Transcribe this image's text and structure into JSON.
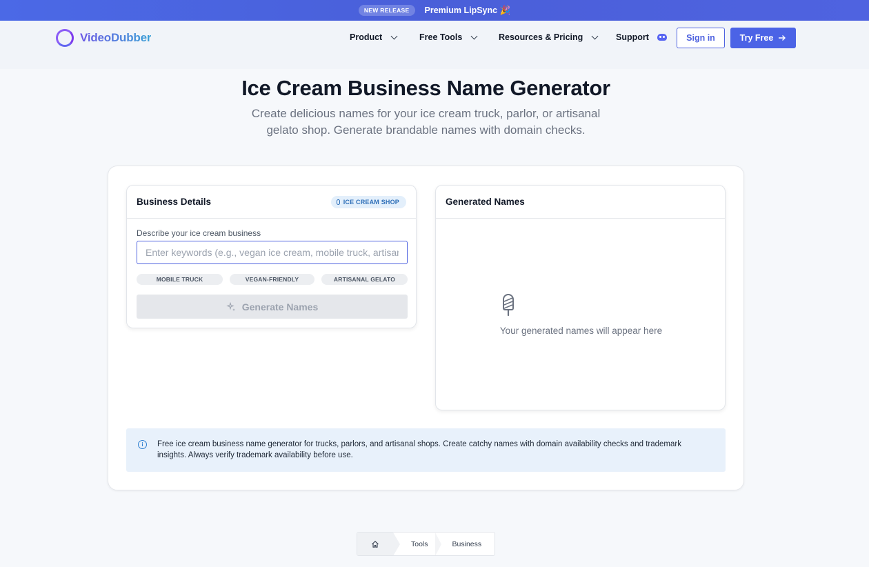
{
  "banner": {
    "badge": "NEW RELEASE",
    "text": "Premium LipSync 🎉"
  },
  "header": {
    "logo_text": "VideoDubber",
    "nav": [
      {
        "label": "Product"
      },
      {
        "label": "Free Tools"
      },
      {
        "label": "Resources & Pricing"
      },
      {
        "label": "Support"
      }
    ],
    "signin_label": "Sign in",
    "try_label": "Try Free"
  },
  "hero": {
    "title": "Ice Cream Business Name Generator",
    "subtitle": "Create delicious names for your ice cream truck, parlor, or artisanal gelato shop. Generate brandable names with domain checks."
  },
  "details": {
    "title": "Business Details",
    "badge": "ICE CREAM SHOP",
    "field_label": "Describe your ice cream business",
    "input_value": "",
    "input_placeholder": "Enter keywords (e.g., vegan ice cream, mobile truck, artisanal)",
    "chips": [
      "MOBILE TRUCK",
      "VEGAN-FRIENDLY",
      "ARTISANAL GELATO"
    ],
    "generate_label": "Generate Names"
  },
  "results": {
    "title": "Generated Names",
    "empty_text": "Your generated names will appear here"
  },
  "info": {
    "text": "Free ice cream business name generator for trucks, parlors, and artisanal shops. Create catchy names with domain availability checks and trademark insights. Always verify trademark availability before use."
  },
  "breadcrumb": {
    "items": [
      "Tools",
      "Business"
    ]
  },
  "colors": {
    "accent": "#4b63e6",
    "brand_purple": "#8b5cf6",
    "info_bg": "#e8f1fb"
  }
}
